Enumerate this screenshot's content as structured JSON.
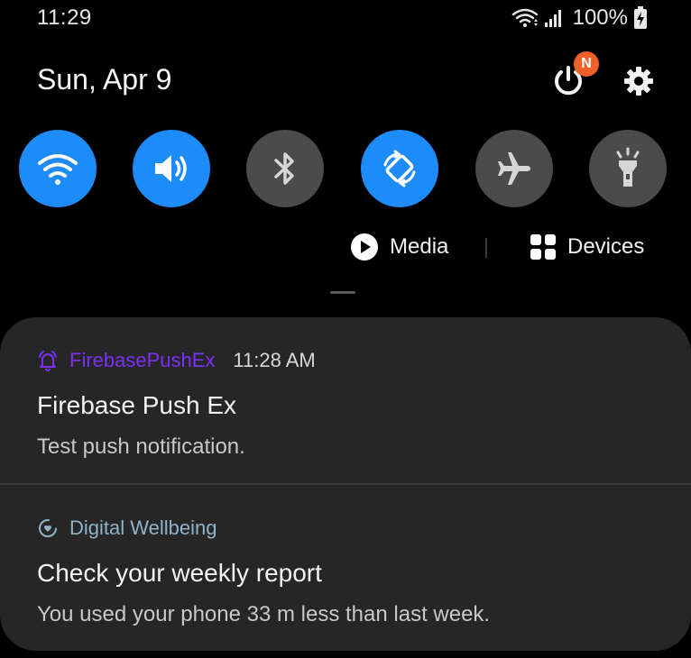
{
  "status_bar": {
    "time": "11:29",
    "battery_percent": "100%",
    "icons": [
      "wifi-icon",
      "signal-icon",
      "battery-charging-icon"
    ]
  },
  "header": {
    "date": "Sun, Apr 9",
    "power_badge": "N",
    "icons": [
      "power-icon",
      "gear-icon"
    ]
  },
  "quick_toggles": [
    {
      "name": "wifi",
      "icon": "wifi-icon",
      "state": "on"
    },
    {
      "name": "sound",
      "icon": "speaker-icon",
      "state": "on"
    },
    {
      "name": "bluetooth",
      "icon": "bluetooth-icon",
      "state": "off"
    },
    {
      "name": "auto-rotate",
      "icon": "rotate-icon",
      "state": "on"
    },
    {
      "name": "airplane-mode",
      "icon": "airplane-icon",
      "state": "off"
    },
    {
      "name": "flashlight",
      "icon": "flashlight-icon",
      "state": "off"
    }
  ],
  "media_row": {
    "media_label": "Media",
    "devices_label": "Devices"
  },
  "notifications": [
    {
      "app": "FirebasePushEx",
      "time": "11:28 AM",
      "title": "Firebase Push Ex",
      "body": "Test push notification.",
      "app_color": "#7b2ff7",
      "icon": "bell-icon"
    },
    {
      "app": "Digital Wellbeing",
      "time": "",
      "title": "Check your weekly report",
      "body": "You used your phone 33 m less than last week.",
      "app_color": "#8fb3c9",
      "icon": "wellbeing-icon"
    }
  ],
  "colors": {
    "background": "#000000",
    "toggle_on": "#1d8cf8",
    "toggle_off": "#4b4b4b",
    "panel": "#262626",
    "badge": "#f0612a"
  }
}
